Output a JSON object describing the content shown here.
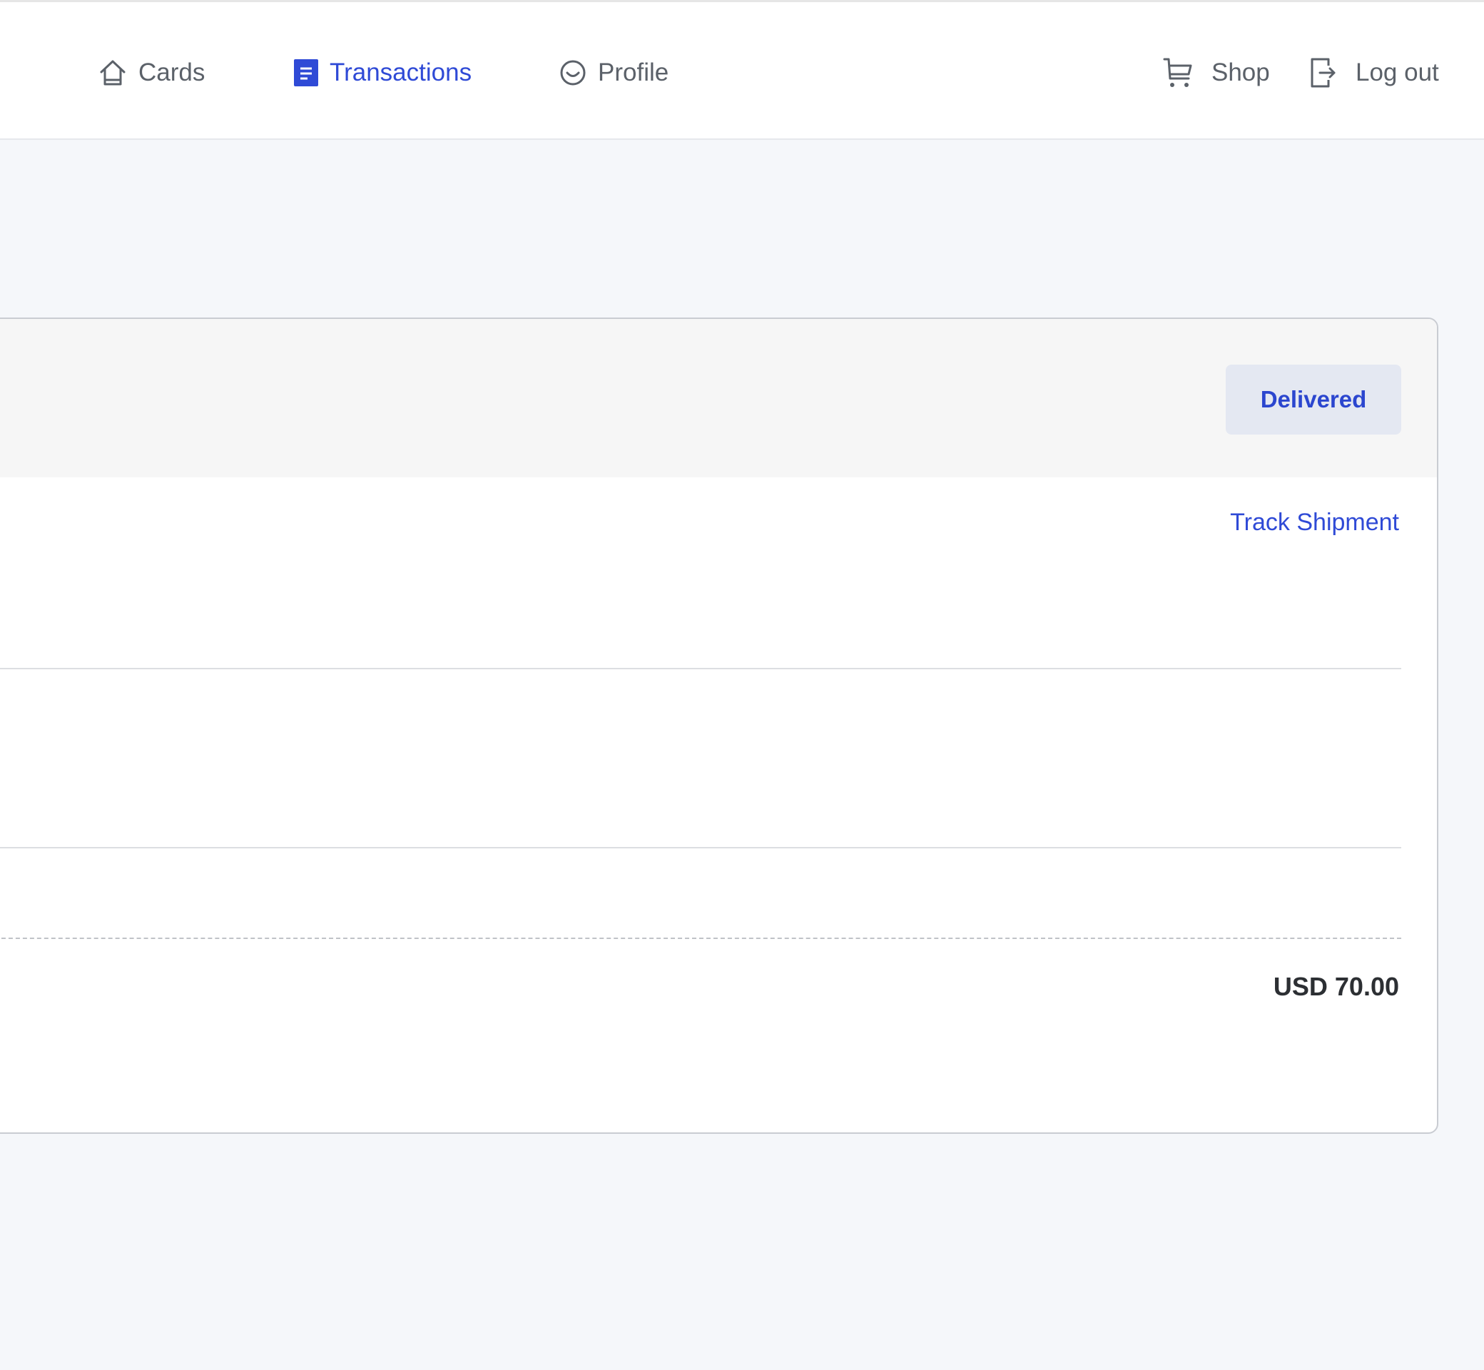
{
  "nav": {
    "cards_label": "Cards",
    "transactions_label": "Transactions",
    "profile_label": "Profile",
    "shop_label": "Shop",
    "logout_label": "Log out",
    "active_tab": "Transactions"
  },
  "order": {
    "status": "Delivered",
    "track_label": "Track Shipment",
    "total": "USD 70.00"
  },
  "colors": {
    "accent": "#2f4ad6",
    "badge_bg": "#e4e8f2",
    "page_bg": "#f5f7fa",
    "header_bg": "#f6f6f6"
  },
  "icons": {
    "cards": "home-icon",
    "transactions": "document-icon",
    "profile": "smiley-circle-icon",
    "shop": "cart-icon",
    "logout": "logout-icon"
  }
}
